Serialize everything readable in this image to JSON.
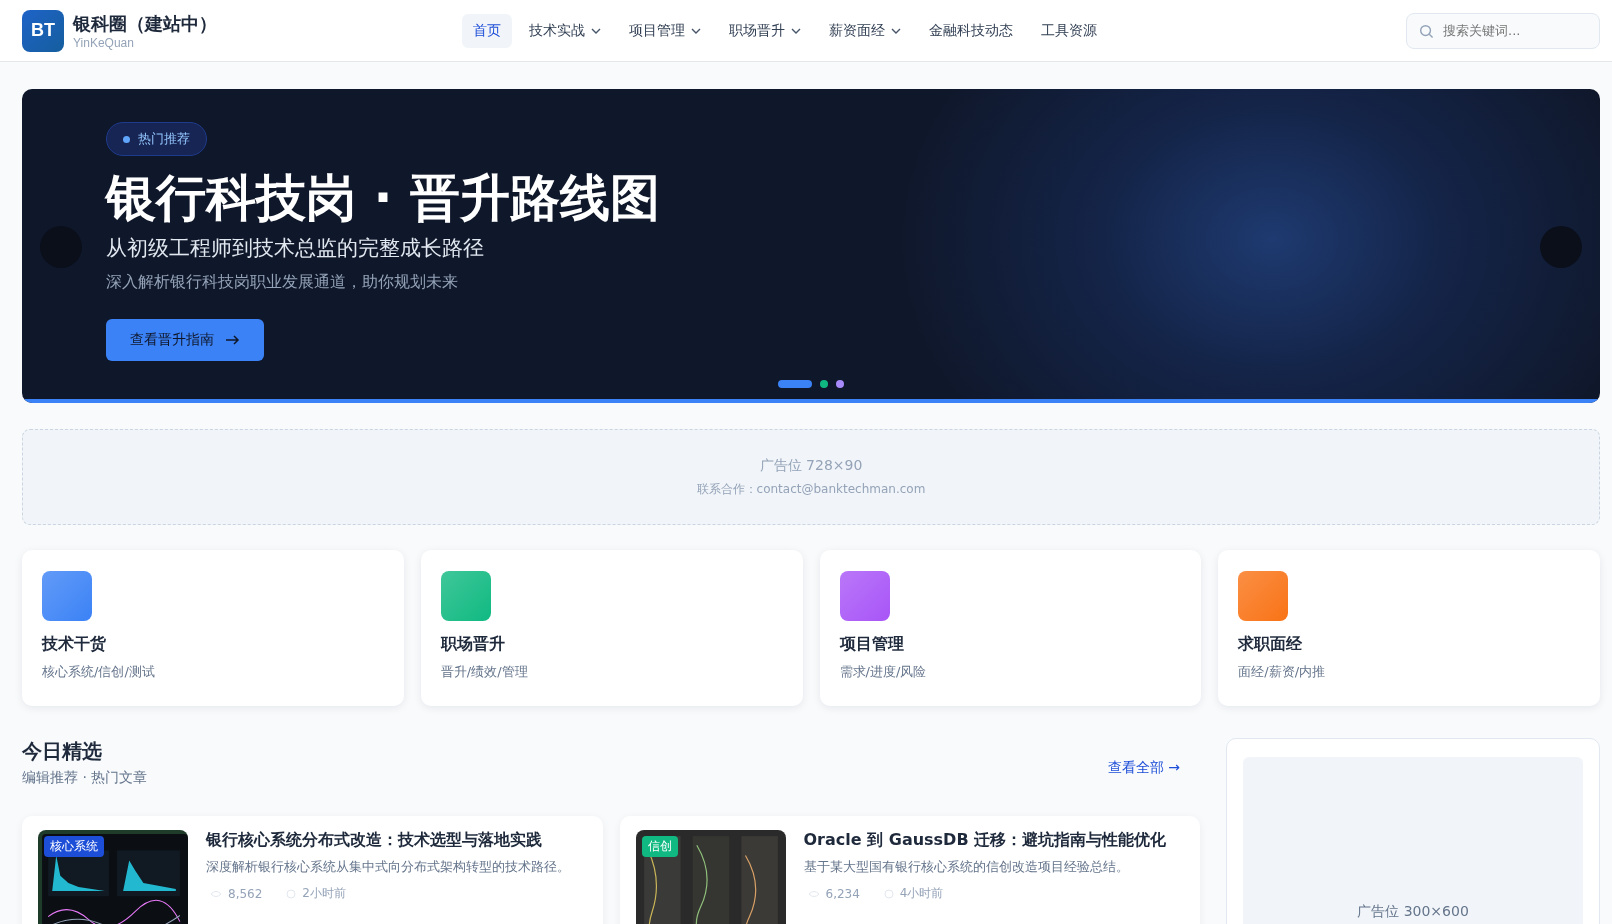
{
  "header": {
    "logo": "BT",
    "title": "银科圈（建站中）",
    "subtitle": "YinKeQuan",
    "nav": [
      {
        "label": "首页",
        "selected": true,
        "dropdown": false
      },
      {
        "label": "技术实战",
        "selected": false,
        "dropdown": true
      },
      {
        "label": "项目管理",
        "selected": false,
        "dropdown": true
      },
      {
        "label": "职场晋升",
        "selected": false,
        "dropdown": true
      },
      {
        "label": "薪资面经",
        "selected": false,
        "dropdown": true
      },
      {
        "label": "金融科技动态",
        "selected": false,
        "dropdown": false
      },
      {
        "label": "工具资源",
        "selected": false,
        "dropdown": false
      }
    ],
    "search": {
      "placeholder": "搜索关键词..."
    }
  },
  "hero": {
    "badge": "热门推荐",
    "title": "银行科技岗 · 晋升路线图",
    "subtitle": "从初级工程师到技术总监的完整成长路径",
    "description": "深入解析银行科技岗职业发展通道，助你规划未来",
    "button": "查看晋升指南",
    "dots": [
      {
        "selected": true,
        "color": "#3b82f6"
      },
      {
        "selected": false,
        "color": "#10b981"
      },
      {
        "selected": false,
        "color": "#a78bfa"
      }
    ]
  },
  "ad_banner": {
    "title": "广告位 728×90",
    "contact": "联系合作：contact@banktechman.com"
  },
  "categories": [
    {
      "title": "技术干货",
      "tags": "核心系统/信创/测试",
      "color": "#3b82f6"
    },
    {
      "title": "职场晋升",
      "tags": "晋升/绩效/管理",
      "color": "#10b981"
    },
    {
      "title": "项目管理",
      "tags": "需求/进度/风险",
      "color": "#a855f7"
    },
    {
      "title": "求职面经",
      "tags": "面经/薪资/内推",
      "color": "#f97316"
    }
  ],
  "featured": {
    "title": "今日精选",
    "subtitle": "编辑推荐 · 热门文章",
    "view_all": "查看全部 →",
    "articles": [
      {
        "tag": "核心系统",
        "color": "#1d4ed8",
        "kind": "dashboard",
        "title": "银行核心系统分布式改造：技术选型与落地实践",
        "summary": "深度解析银行核心系统从集中式向分布式架构转型的技术路径。",
        "views": "8,562",
        "time": "2小时前"
      },
      {
        "tag": "信创",
        "color": "#10b981",
        "kind": "servers",
        "title": "Oracle 到 GaussDB 迁移：避坑指南与性能优化",
        "summary": "基于某大型国有银行核心系统的信创改造项目经验总结。",
        "views": "6,234",
        "time": "4小时前"
      }
    ]
  },
  "sidebar_ad": {
    "title": "广告位 300×600"
  }
}
